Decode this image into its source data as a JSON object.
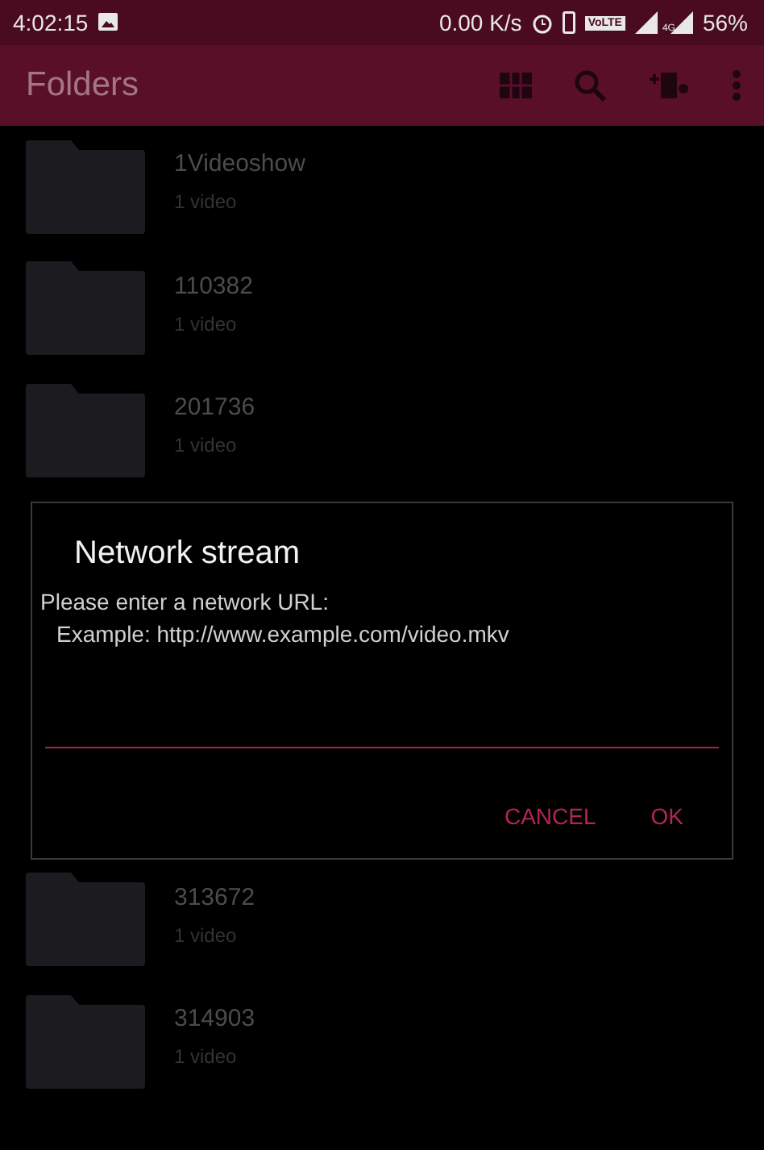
{
  "status_bar": {
    "time": "4:02:15",
    "speed": "0.00 K/s",
    "network_badge": "VoLTE",
    "signal_label": "4G",
    "battery": "56%"
  },
  "toolbar": {
    "title": "Folders"
  },
  "folders_above": [
    {
      "name": "1Videoshow",
      "count": "1 video"
    },
    {
      "name": "110382",
      "count": "1 video"
    },
    {
      "name": "201736",
      "count": "1 video"
    }
  ],
  "dialog": {
    "title": "Network stream",
    "message": "Please enter a network URL:",
    "example": "Example: http://www.example.com/video.mkv",
    "buttons": [
      "CANCEL",
      "OK"
    ]
  },
  "folders_below": [
    {
      "name": "313672",
      "count": "1 video"
    },
    {
      "name": "314903",
      "count": "1 video"
    }
  ]
}
